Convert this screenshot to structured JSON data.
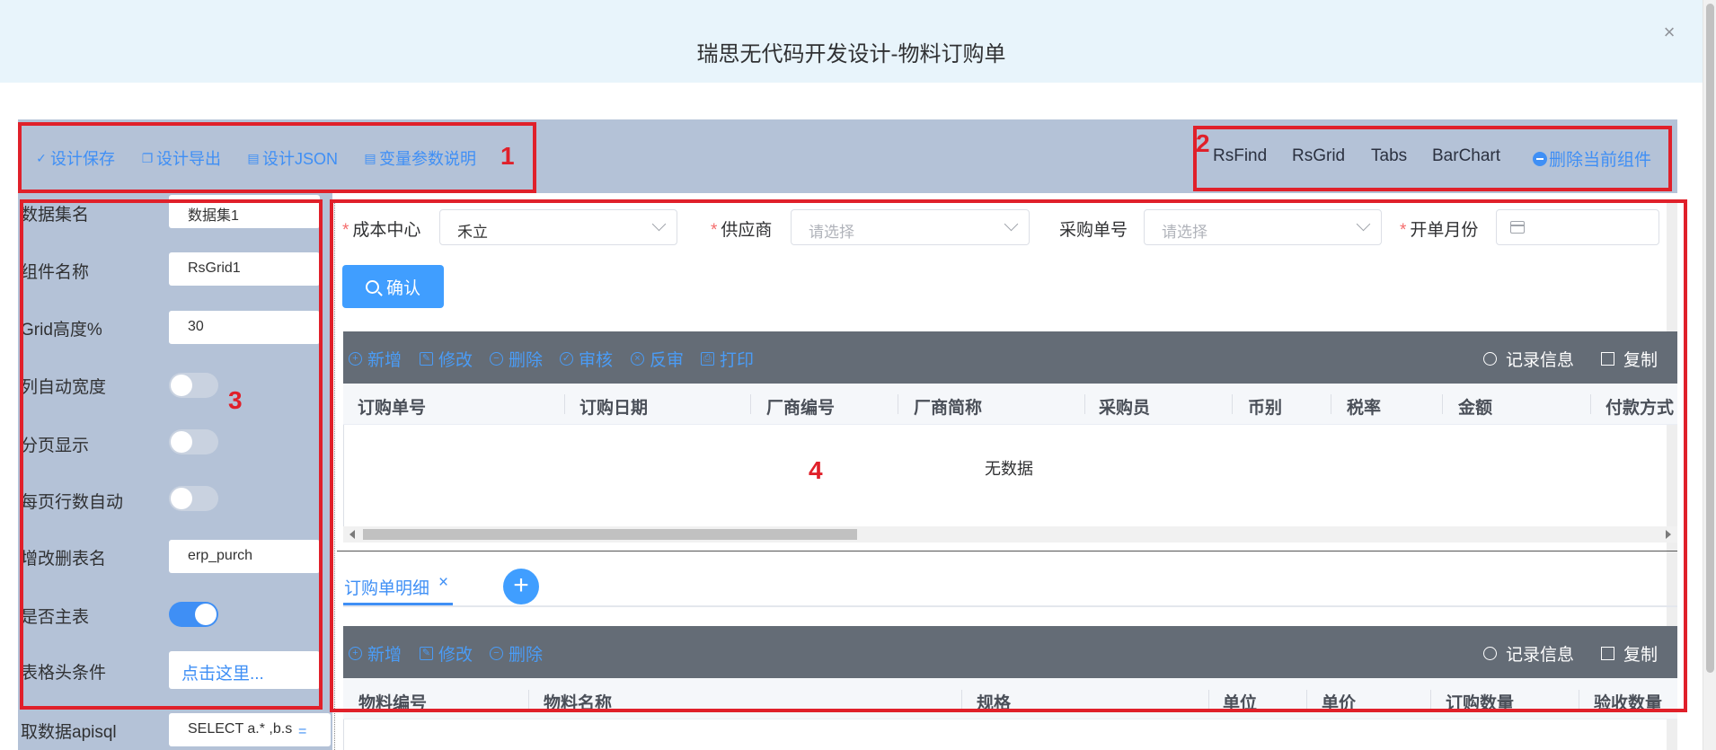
{
  "dialog": {
    "title": "瑞思无代码开发设计-物料订购单",
    "close_symbol": "×"
  },
  "toolbar": {
    "left": [
      {
        "icon": "check-icon",
        "label": "设计保存"
      },
      {
        "icon": "copy-icon",
        "label": "设计导出"
      },
      {
        "icon": "document-icon",
        "label": "设计JSON"
      },
      {
        "icon": "document-icon",
        "label": "变量参数说明"
      }
    ],
    "components": [
      "RsFind",
      "RsGrid",
      "Tabs",
      "BarChart"
    ],
    "delete_label": "删除当前组件"
  },
  "annotations": [
    "1",
    "2",
    "3",
    "4"
  ],
  "properties": [
    {
      "label": "数据集名",
      "type": "input",
      "value": "数据集1"
    },
    {
      "label": "组件名称",
      "type": "input",
      "value": "RsGrid1"
    },
    {
      "label": "Grid高度%",
      "type": "input",
      "value": "30"
    },
    {
      "label": "列自动宽度",
      "type": "toggle",
      "on": false
    },
    {
      "label": "分页显示",
      "type": "toggle",
      "on": false
    },
    {
      "label": "每页行数自动",
      "type": "toggle",
      "on": false
    },
    {
      "label": "增改删表名",
      "type": "input",
      "value": "erp_purch"
    },
    {
      "label": "是否主表",
      "type": "toggle",
      "on": true
    },
    {
      "label": "表格头条件",
      "type": "link",
      "value": "点击这里..."
    },
    {
      "label": "取数据apisql",
      "type": "input",
      "value": "SELECT a.* ,b.s",
      "suffix": "="
    }
  ],
  "query": {
    "fields": [
      {
        "label": "成本中心",
        "required": true,
        "value": "禾立",
        "placeholder": ""
      },
      {
        "label": "供应商",
        "required": true,
        "value": "",
        "placeholder": "请选择"
      },
      {
        "label": "采购单号",
        "required": false,
        "value": "",
        "placeholder": "请选择"
      },
      {
        "label": "开单月份",
        "required": true,
        "value": "",
        "placeholder": ""
      }
    ],
    "confirm_label": "确认"
  },
  "master_grid": {
    "actions": [
      "新增",
      "修改",
      "删除",
      "审核",
      "反审",
      "打印"
    ],
    "right_actions": [
      "记录信息",
      "复制"
    ],
    "columns": [
      "订购单号",
      "订购日期",
      "厂商编号",
      "厂商简称",
      "采购员",
      "币别",
      "税率",
      "金额",
      "付款方式"
    ],
    "empty_text": "无数据"
  },
  "tabs": [
    {
      "label": "订购单明细",
      "active": true
    }
  ],
  "add_tab_symbol": "+",
  "detail_grid": {
    "actions": [
      "新增",
      "修改",
      "删除"
    ],
    "right_actions": [
      "记录信息",
      "复制"
    ],
    "columns": [
      "物料编号",
      "物料名称",
      "规格",
      "单位",
      "单价",
      "订购数量",
      "验收数量"
    ]
  },
  "colors": {
    "accent": "#409eff",
    "annotation": "#e0202a",
    "panel": "#b4c2d7",
    "grid_toolbar": "#646c76"
  }
}
